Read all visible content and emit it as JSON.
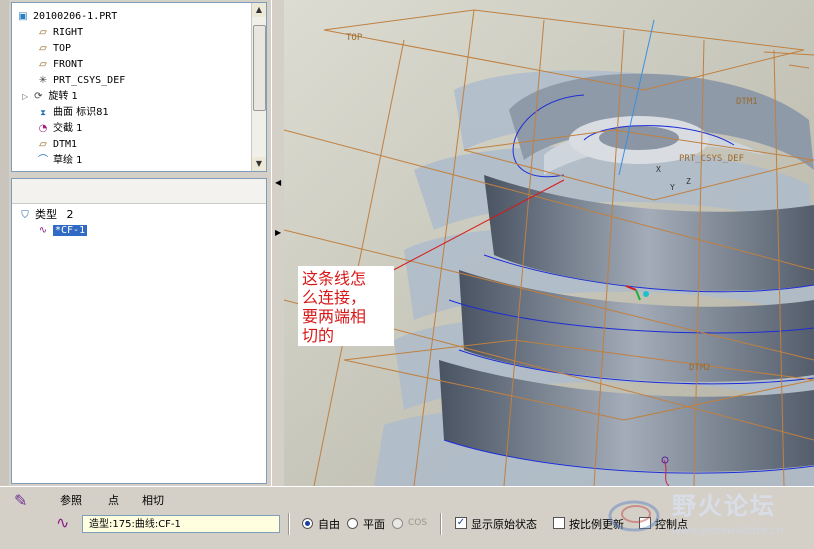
{
  "model_tree": {
    "items": [
      {
        "label": "20100206-1.PRT",
        "icon": "part-icon"
      },
      {
        "label": "RIGHT",
        "icon": "datum-plane-icon"
      },
      {
        "label": "TOP",
        "icon": "datum-plane-icon"
      },
      {
        "label": "FRONT",
        "icon": "datum-plane-icon"
      },
      {
        "label": "PRT_CSYS_DEF",
        "icon": "csys-icon"
      },
      {
        "label": "旋转 1",
        "icon": "revolve-icon"
      },
      {
        "label": "曲面 标识81",
        "icon": "surface-icon"
      },
      {
        "label": "交截 1",
        "icon": "intersect-icon"
      },
      {
        "label": "DTM1",
        "icon": "datum-plane-icon"
      },
      {
        "label": "草绘 1",
        "icon": "sketch-icon"
      }
    ]
  },
  "selection_tree": {
    "type_label": "类型",
    "type_count": "2",
    "item_label": "*CF-1"
  },
  "viewport": {
    "datum_labels": {
      "top": "TOP",
      "dtm1": "DTM1",
      "dtm2": "DTM2",
      "csys": "PRT_CSYS_DEF",
      "axis_x": "X",
      "axis_y": "Y",
      "axis_z": "Z"
    },
    "annotation": [
      "这条线怎",
      "么连接，",
      "要两端相",
      "切的"
    ],
    "colors": {
      "background": "#c6c4b8",
      "surface": "#a8b4c2",
      "datum": "#c08040",
      "curve": "#1d2dd6",
      "annotation": "#d81818"
    }
  },
  "bottom_bar": {
    "tabs": [
      "参照",
      "点",
      "相切"
    ],
    "curve_path": "造型:175:曲线:CF-1",
    "options": {
      "free": "自由",
      "plane": "平面",
      "cos": "COS",
      "show_original": "显示原始状态",
      "scale_update": "按比例更新",
      "control_points": "控制点"
    }
  },
  "watermark": {
    "title": "野火论坛",
    "url": "www.proewildfire.cn"
  }
}
